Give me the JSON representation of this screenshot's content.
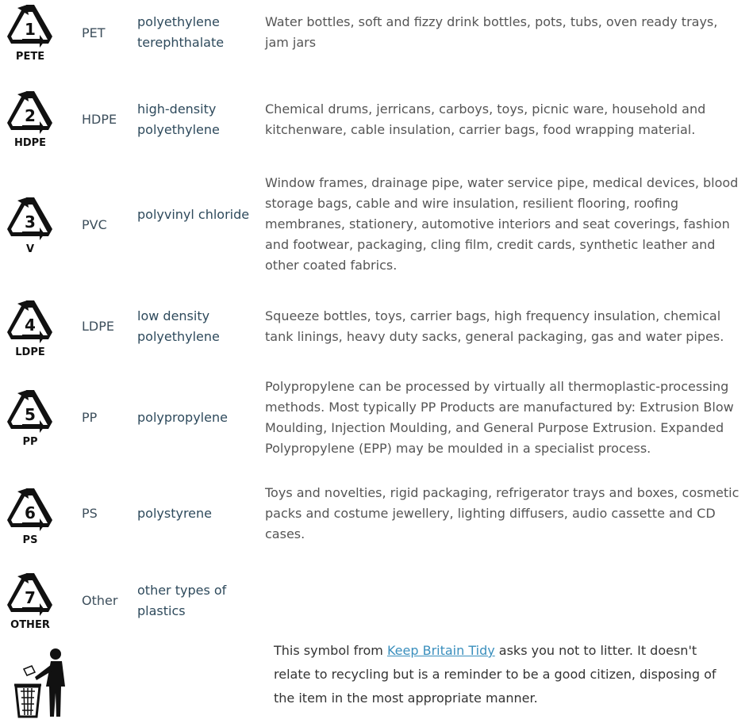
{
  "rows": [
    {
      "number": "1",
      "code": "PETE",
      "abbr": "PET",
      "name": "polyethylene terephthalate",
      "uses": "Water bottles, soft and fizzy drink bottles, pots, tubs, oven ready trays, jam jars"
    },
    {
      "number": "2",
      "code": "HDPE",
      "abbr": "HDPE",
      "name": "high-density polyethylene",
      "uses": "Chemical drums, jerricans, carboys, toys, picnic ware, household and kitchenware, cable insulation, carrier bags, food wrapping material."
    },
    {
      "number": "3",
      "code": "V",
      "abbr": "PVC",
      "name": "polyvinyl chloride",
      "uses": "Window frames, drainage pipe, water service pipe, medical devices, blood storage bags, cable and wire insulation, resilient flooring, roofing membranes, stationery, automotive interiors and seat coverings, fashion and footwear, packaging, cling film, credit cards, synthetic leather and other coated fabrics."
    },
    {
      "number": "4",
      "code": "LDPE",
      "abbr": "LDPE",
      "name": "low density polyethylene",
      "uses": "Squeeze bottles, toys, carrier bags, high frequency insulation, chemical tank linings, heavy duty sacks, general packaging, gas and water pipes."
    },
    {
      "number": "5",
      "code": "PP",
      "abbr": "PP",
      "name": "polypropylene",
      "uses": "Polypropylene can be processed by virtually all thermoplastic-processing methods. Most typically PP Products are manufactured by: Extrusion Blow Moulding, Injection Moulding, and General Purpose Extrusion. Expanded Polypropylene (EPP) may be moulded in a specialist process."
    },
    {
      "number": "6",
      "code": "PS",
      "abbr": "PS",
      "name": "polystyrene",
      "uses": "Toys and novelties, rigid packaging, refrigerator trays and boxes, cosmetic packs and costume jewellery, lighting diffusers, audio cassette and CD cases."
    },
    {
      "number": "7",
      "code": "OTHER",
      "abbr": "Other",
      "name": "other types of plastics",
      "uses": ""
    }
  ],
  "litter": {
    "text_before": "This symbol from ",
    "link": "Keep Britain Tidy",
    "text_after": " asks you not to litter. It doesn't relate to recycling but is a reminder to be a good citizen, disposing of the item in the most appropriate manner."
  }
}
